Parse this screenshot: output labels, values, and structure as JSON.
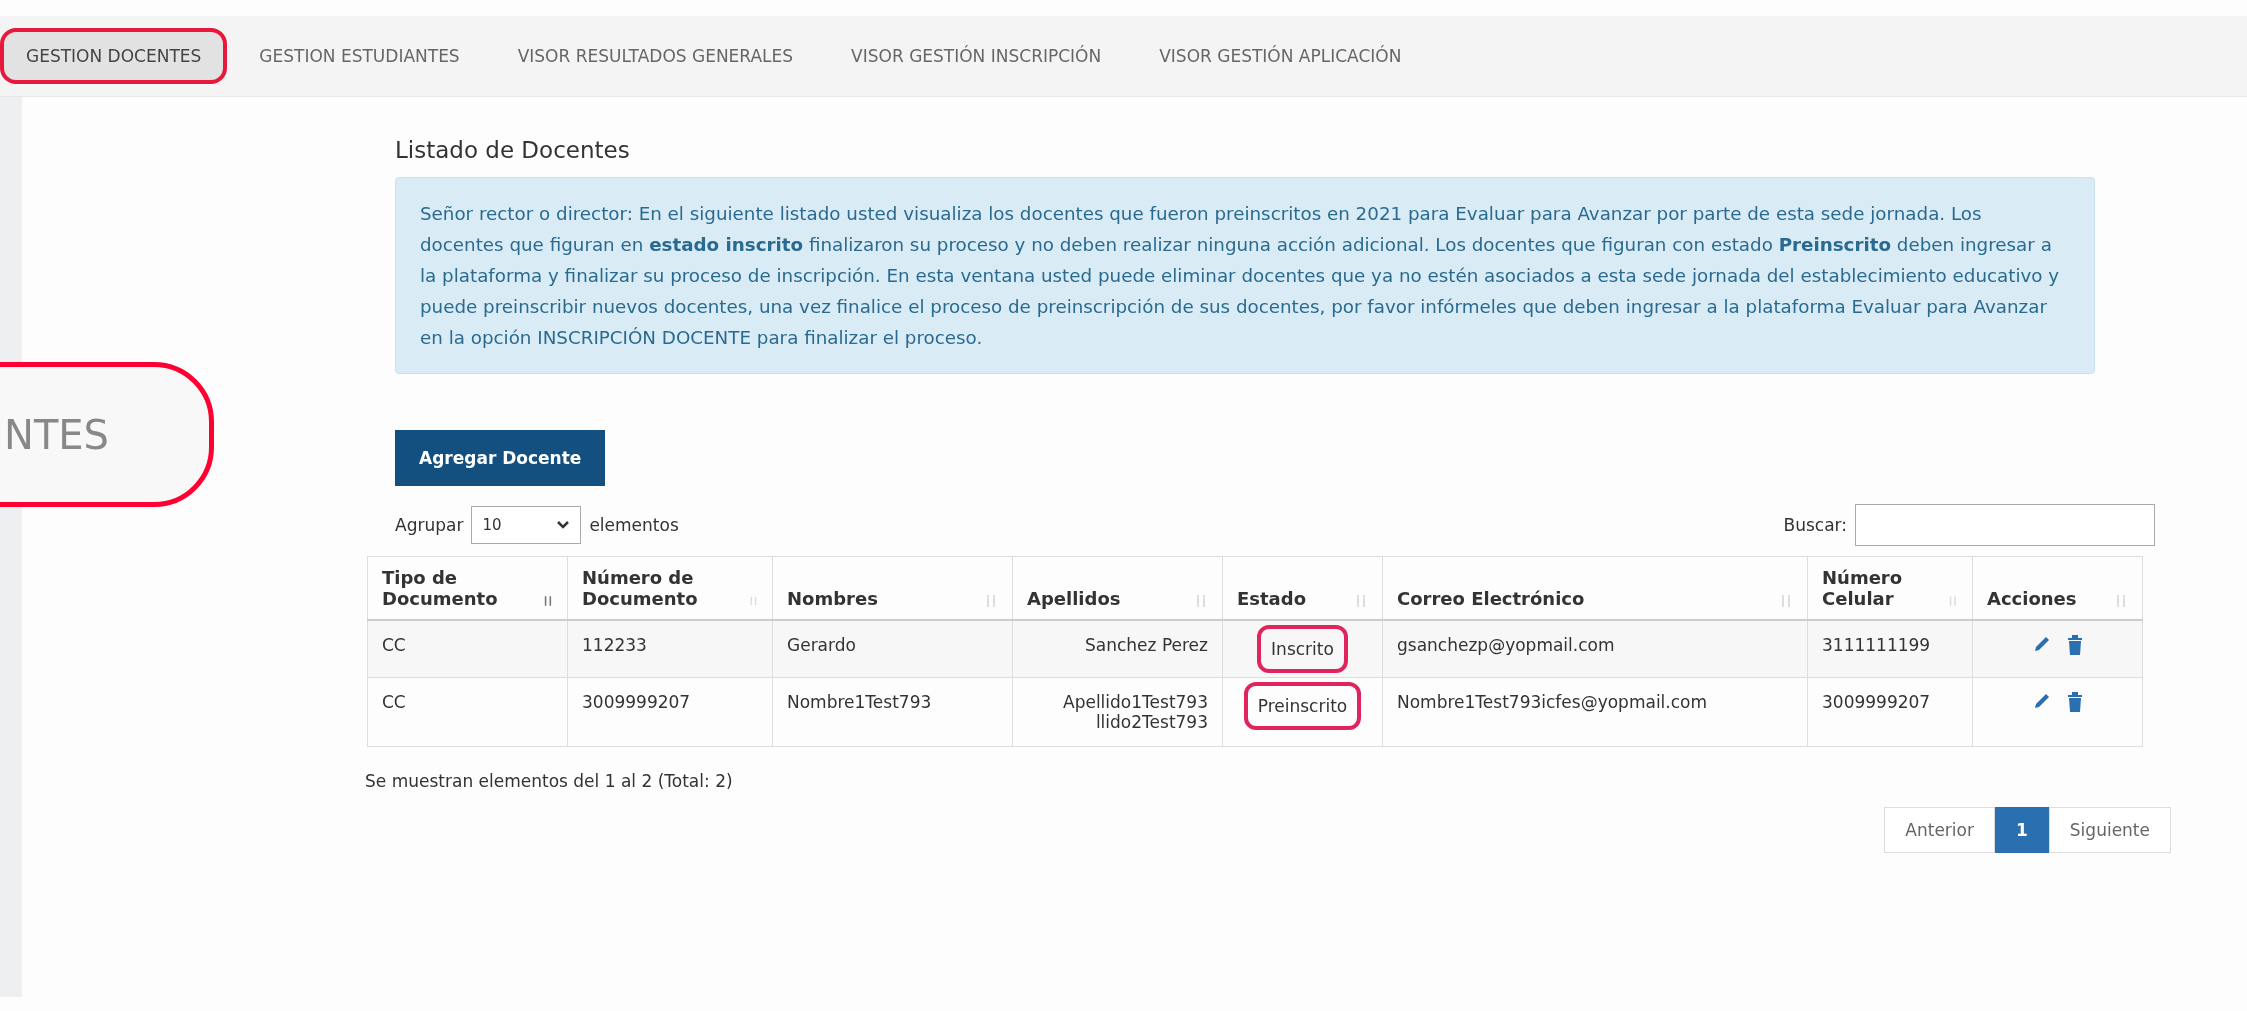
{
  "nav_tabs": [
    {
      "label": "GESTION DOCENTES",
      "selected": true,
      "highlighted": true
    },
    {
      "label": "GESTION ESTUDIANTES",
      "selected": false,
      "highlighted": false
    },
    {
      "label": "VISOR RESULTADOS GENERALES",
      "selected": false,
      "highlighted": false
    },
    {
      "label": "VISOR GESTIÓN INSCRIPCIÓN",
      "selected": false,
      "highlighted": false
    },
    {
      "label": "VISOR GESTIÓN APLICACIÓN",
      "selected": false,
      "highlighted": false
    }
  ],
  "sidebar": {
    "item_label": "NTES",
    "highlighted": true
  },
  "title": "Listado de Docentes",
  "notice": "Señor rector o director: En el siguiente listado usted visualiza los docentes que fueron preinscritos en 2021 para Evaluar para Avanzar por parte de esta sede jornada. Los docentes que figuran en **estado inscrito** finalizaron su proceso y no deben realizar ninguna acción adicional. Los docentes que figuran con estado **Preinscrito** deben ingresar a la plataforma y finalizar su proceso de inscripción. En esta ventana usted puede eliminar docentes que ya no estén asociados a esta sede jornada del establecimiento educativo y puede preinscribir nuevos docentes, una vez finalice el proceso de preinscripción de sus docentes, por favor infórmeles que deben ingresar a la plataforma Evaluar para Avanzar en la opción INSCRIPCIÓN DOCENTE para finalizar el proceso.",
  "add_button": "Agregar Docente",
  "page_size": {
    "label": "Agrupar",
    "value": "10",
    "suffix": "elementos"
  },
  "search": {
    "label": "Buscar:"
  },
  "table": {
    "columns": [
      {
        "label": "Tipo de Documento",
        "sorted": true
      },
      {
        "label": "Número de Documento",
        "sorted": false
      },
      {
        "label": "Nombres",
        "sorted": false
      },
      {
        "label": "Apellidos",
        "sorted": false
      },
      {
        "label": "Estado",
        "sorted": false
      },
      {
        "label": "Correo Electrónico",
        "sorted": false
      },
      {
        "label": "Número Celular",
        "sorted": false
      },
      {
        "label": "Acciones",
        "sorted": false
      }
    ],
    "rows": [
      {
        "tipo": "CC",
        "numero": "112233",
        "nombres": "Gerardo",
        "apellidos": [
          "Sanchez Perez"
        ],
        "estado": "Inscrito",
        "estado_highlighted": true,
        "correo": "gsanchezp@yopmail.com",
        "celular": "3111111199"
      },
      {
        "tipo": "CC",
        "numero": "3009999207",
        "nombres": "Nombre1Test793",
        "apellidos": [
          "Apellido1Test793",
          "llido2Test793"
        ],
        "estado": "Preinscrito",
        "estado_highlighted": true,
        "correo": "Nombre1Test793icfes@yopmail.com",
        "celular": "3009999207"
      }
    ]
  },
  "footer": "Se muestran elementos del 1 al 2 (Total: 2)",
  "pagination": [
    {
      "label": "Anterior",
      "selected": false
    },
    {
      "label": "1",
      "selected": true
    },
    {
      "label": "Siguiente",
      "selected": false
    }
  ]
}
